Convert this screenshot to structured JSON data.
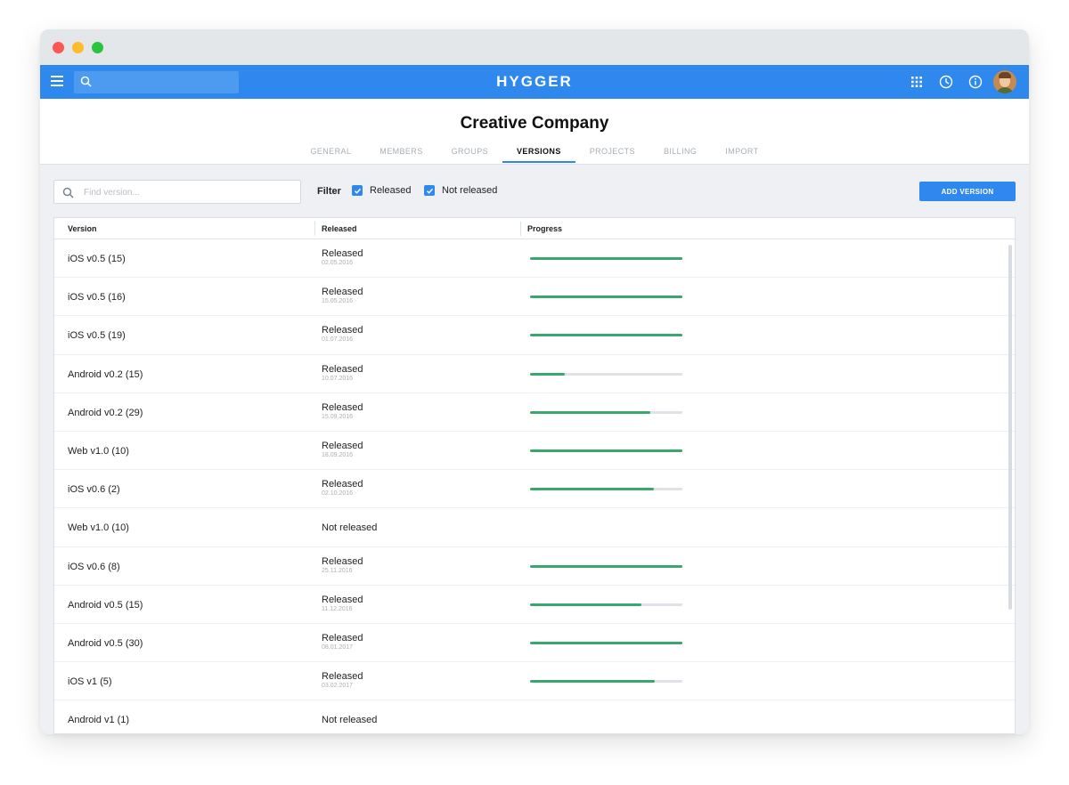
{
  "app": {
    "logo": "HYGGER"
  },
  "company": {
    "title": "Creative Company"
  },
  "tabs": [
    {
      "label": "GENERAL",
      "active": false
    },
    {
      "label": "MEMBERS",
      "active": false
    },
    {
      "label": "GROUPS",
      "active": false
    },
    {
      "label": "VERSIONS",
      "active": true
    },
    {
      "label": "PROJECTS",
      "active": false
    },
    {
      "label": "BILLING",
      "active": false
    },
    {
      "label": "IMPORT",
      "active": false
    }
  ],
  "toolbar": {
    "search_placeholder": "Find version...",
    "filter_label": "Filter",
    "filter_released": "Released",
    "filter_not_released": "Not released",
    "add_button": "ADD VERSION"
  },
  "table": {
    "headers": {
      "version": "Version",
      "released": "Released",
      "progress": "Progress"
    },
    "rows": [
      {
        "version": "iOS v0.5 (15)",
        "status": "Released",
        "date": "02.05.2016",
        "progress": 1.0
      },
      {
        "version": "iOS v0.5 (16)",
        "status": "Released",
        "date": "15.05.2016",
        "progress": 1.0
      },
      {
        "version": "iOS v0.5 (19)",
        "status": "Released",
        "date": "01.07.2016",
        "progress": 1.0
      },
      {
        "version": "Android v0.2 (15)",
        "status": "Released",
        "date": "10.07.2016",
        "progress": 0.23
      },
      {
        "version": "Android v0.2 (29)",
        "status": "Released",
        "date": "15.09.2016",
        "progress": 0.79
      },
      {
        "version": "Web v1.0 (10)",
        "status": "Released",
        "date": "18.09.2016",
        "progress": 1.0
      },
      {
        "version": "iOS v0.6 (2)",
        "status": "Released",
        "date": "02.10.2016",
        "progress": 0.81
      },
      {
        "version": "Web v1.0 (10)",
        "status": "Not released",
        "date": "",
        "progress": null
      },
      {
        "version": "iOS v0.6 (8)",
        "status": "Released",
        "date": "25.11.2016",
        "progress": 1.0
      },
      {
        "version": "Android v0.5 (15)",
        "status": "Released",
        "date": "11.12.2016",
        "progress": 0.73
      },
      {
        "version": "Android v0.5 (30)",
        "status": "Released",
        "date": "08.01.2017",
        "progress": 1.0
      },
      {
        "version": "iOS v1 (5)",
        "status": "Released",
        "date": "03.02.2017",
        "progress": 0.82
      },
      {
        "version": "Android v1 (1)",
        "status": "Not released",
        "date": "",
        "progress": null
      }
    ]
  },
  "colors": {
    "accent": "#2e88ee",
    "progress_fill": "#3aa76d",
    "progress_track": "#dfe3e7"
  },
  "icons": [
    "menu-icon",
    "search-icon",
    "apps-grid-icon",
    "clock-icon",
    "info-icon",
    "avatar"
  ]
}
